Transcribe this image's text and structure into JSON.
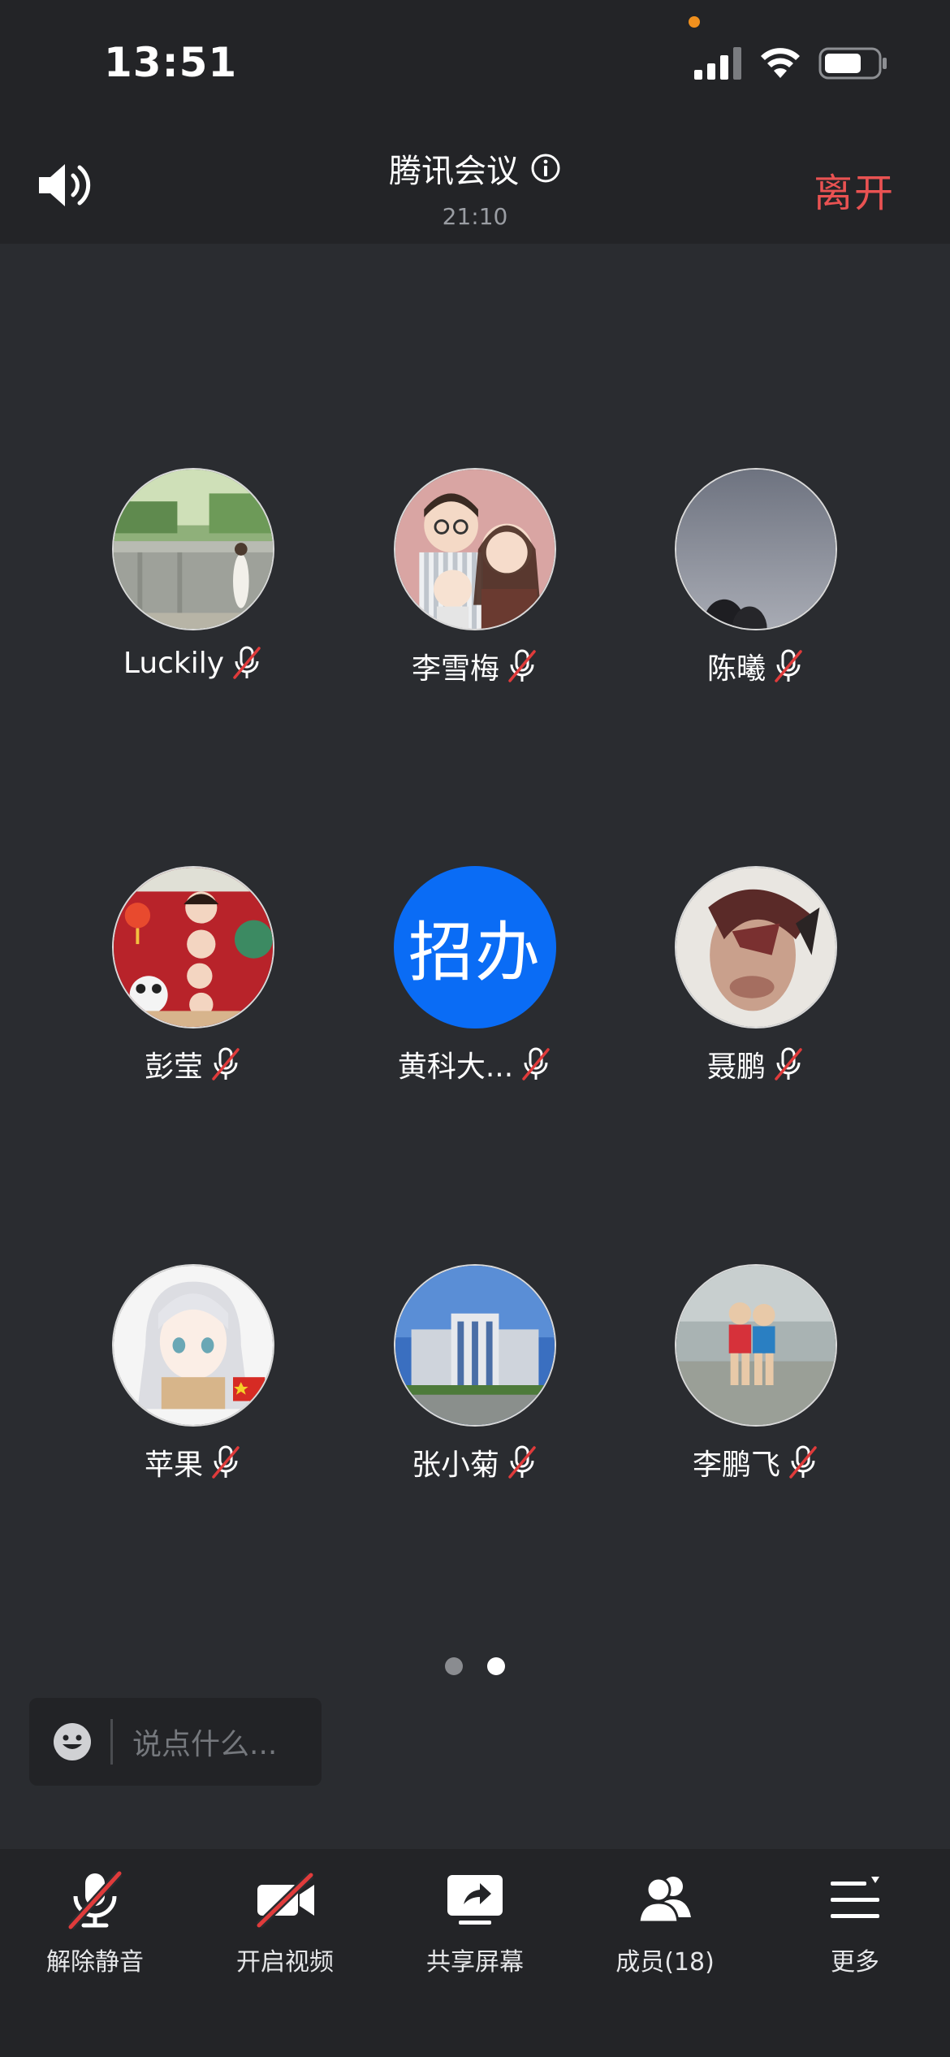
{
  "status_bar": {
    "time": "13:51"
  },
  "header": {
    "title": "腾讯会议",
    "duration": "21:10",
    "leave_label": "离开"
  },
  "participants": [
    {
      "name": "Luckily",
      "avatar": "photo-woman-garden"
    },
    {
      "name": "李雪梅",
      "avatar": "cartoon-family"
    },
    {
      "name": "陈曦",
      "avatar": "photo-dusk-sky"
    },
    {
      "name": "彭莹",
      "avatar": "cartoon-red-festival"
    },
    {
      "name": "黄科大...",
      "avatar": "text",
      "avatar_text": "招办"
    },
    {
      "name": "聂鹏",
      "avatar": "painting-face"
    },
    {
      "name": "苹果",
      "avatar": "anime-girl"
    },
    {
      "name": "张小菊",
      "avatar": "photo-building"
    },
    {
      "name": "李鹏飞",
      "avatar": "photo-kids-beach"
    }
  ],
  "pager": {
    "pages": 2,
    "current": 2
  },
  "chat": {
    "placeholder": "说点什么..."
  },
  "toolbar": [
    {
      "label": "解除静音",
      "icon": "mic-off-icon"
    },
    {
      "label": "开启视频",
      "icon": "video-off-icon"
    },
    {
      "label": "共享屏幕",
      "icon": "share-screen-icon"
    },
    {
      "label": "成员(18)",
      "icon": "members-icon"
    },
    {
      "label": "更多",
      "icon": "more-icon"
    }
  ],
  "colors": {
    "leave": "#e95252",
    "avatar_blue": "#0a6cf5",
    "mute_slash": "#e03b3b"
  }
}
